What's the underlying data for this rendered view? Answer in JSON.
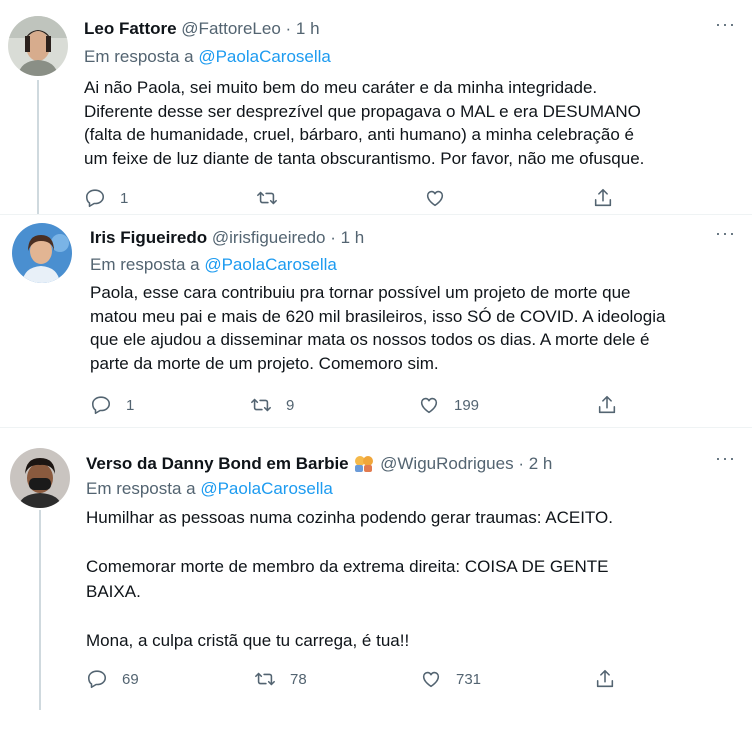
{
  "tweets": [
    {
      "name": "Leo Fattore",
      "handle": "@FattoreLeo",
      "time": "· 1 h",
      "reply_prefix": "Em resposta a ",
      "reply_to": "@PaolaCarosella",
      "lines": [
        "Ai não Paola, sei muito bem do meu caráter e da minha integridade.",
        "Diferente desse ser desprezível que propagava o MAL e era DESUMANO",
        "(falta de humanidade, cruel, bárbaro, anti humano) a minha celebração é",
        "um feixe de luz diante de tanta obscurantismo. Por favor, não me ofusque."
      ],
      "replies": "1",
      "retweets": "",
      "likes": "",
      "more_label": "···"
    },
    {
      "name": "Iris Figueiredo",
      "handle": "@irisfigueiredo",
      "time": "· 1 h",
      "reply_prefix": "Em resposta a ",
      "reply_to": "@PaolaCarosella",
      "lines": [
        "Paola, esse cara contribuiu pra tornar possível um projeto de morte que",
        "matou meu pai e mais de 620 mil brasileiros, isso SÓ de COVID. A ideologia",
        "que ele ajudou a disseminar mata os nossos todos os dias. A morte dele é",
        "parte da morte de um projeto. Comemoro sim."
      ],
      "replies": "1",
      "retweets": "9",
      "likes": "199",
      "more_label": "···"
    },
    {
      "name": "Verso da Danny Bond em Barbie",
      "handle": "@WiguRodrigues",
      "time": "· 2 h",
      "reply_prefix": "Em resposta a ",
      "reply_to": "@PaolaCarosella",
      "lines": [
        "Humilhar as pessoas numa cozinha podendo gerar traumas: ACEITO.",
        "",
        "Comemorar morte de membro da extrema direita: COISA DE GENTE",
        "BAIXA.",
        "",
        "Mona, a culpa cristã que tu carrega, é tua!!"
      ],
      "replies": "69",
      "retweets": "78",
      "likes": "731",
      "more_label": "···"
    }
  ],
  "colors": {
    "link": "#1d9bf0",
    "muted": "#536471",
    "text": "#0f1419",
    "thread_line": "#cfd9de"
  },
  "icons": [
    "reply-icon",
    "retweet-icon",
    "like-icon",
    "share-icon",
    "more-icon",
    "emoji-icon"
  ]
}
